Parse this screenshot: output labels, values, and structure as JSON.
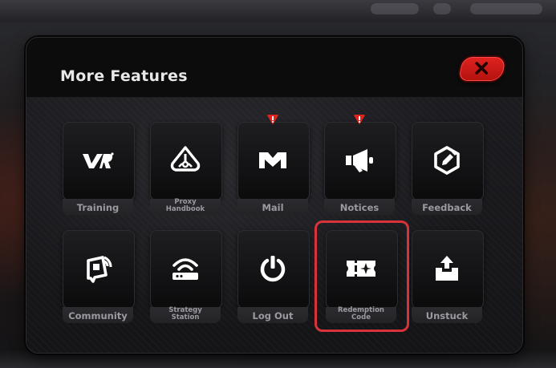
{
  "title": "More Features",
  "colors": {
    "accent_red": "#d8323a",
    "badge_red": "#e0231f",
    "label_gray": "#9a9aa0",
    "icon_white": "#ffffff"
  },
  "features": [
    {
      "label": "Training",
      "icon": "vr-logo-icon",
      "badge": false
    },
    {
      "label": "Proxy\nHandbook",
      "icon": "handbook-icon",
      "badge": false
    },
    {
      "label": "Mail",
      "icon": "mail-icon",
      "badge": true
    },
    {
      "label": "Notices",
      "icon": "megaphone-icon",
      "badge": true
    },
    {
      "label": "Feedback",
      "icon": "feedback-edit-icon",
      "badge": false
    },
    {
      "label": "Community",
      "icon": "community-chat-icon",
      "badge": false
    },
    {
      "label": "Strategy\nStation",
      "icon": "router-icon",
      "badge": false
    },
    {
      "label": "Log Out",
      "icon": "power-icon",
      "badge": false
    },
    {
      "label": "Redemption\nCode",
      "icon": "ticket-icon",
      "badge": false
    },
    {
      "label": "Unstuck",
      "icon": "upload-box-icon",
      "badge": false
    }
  ],
  "selected_feature": "Redemption\nCode"
}
